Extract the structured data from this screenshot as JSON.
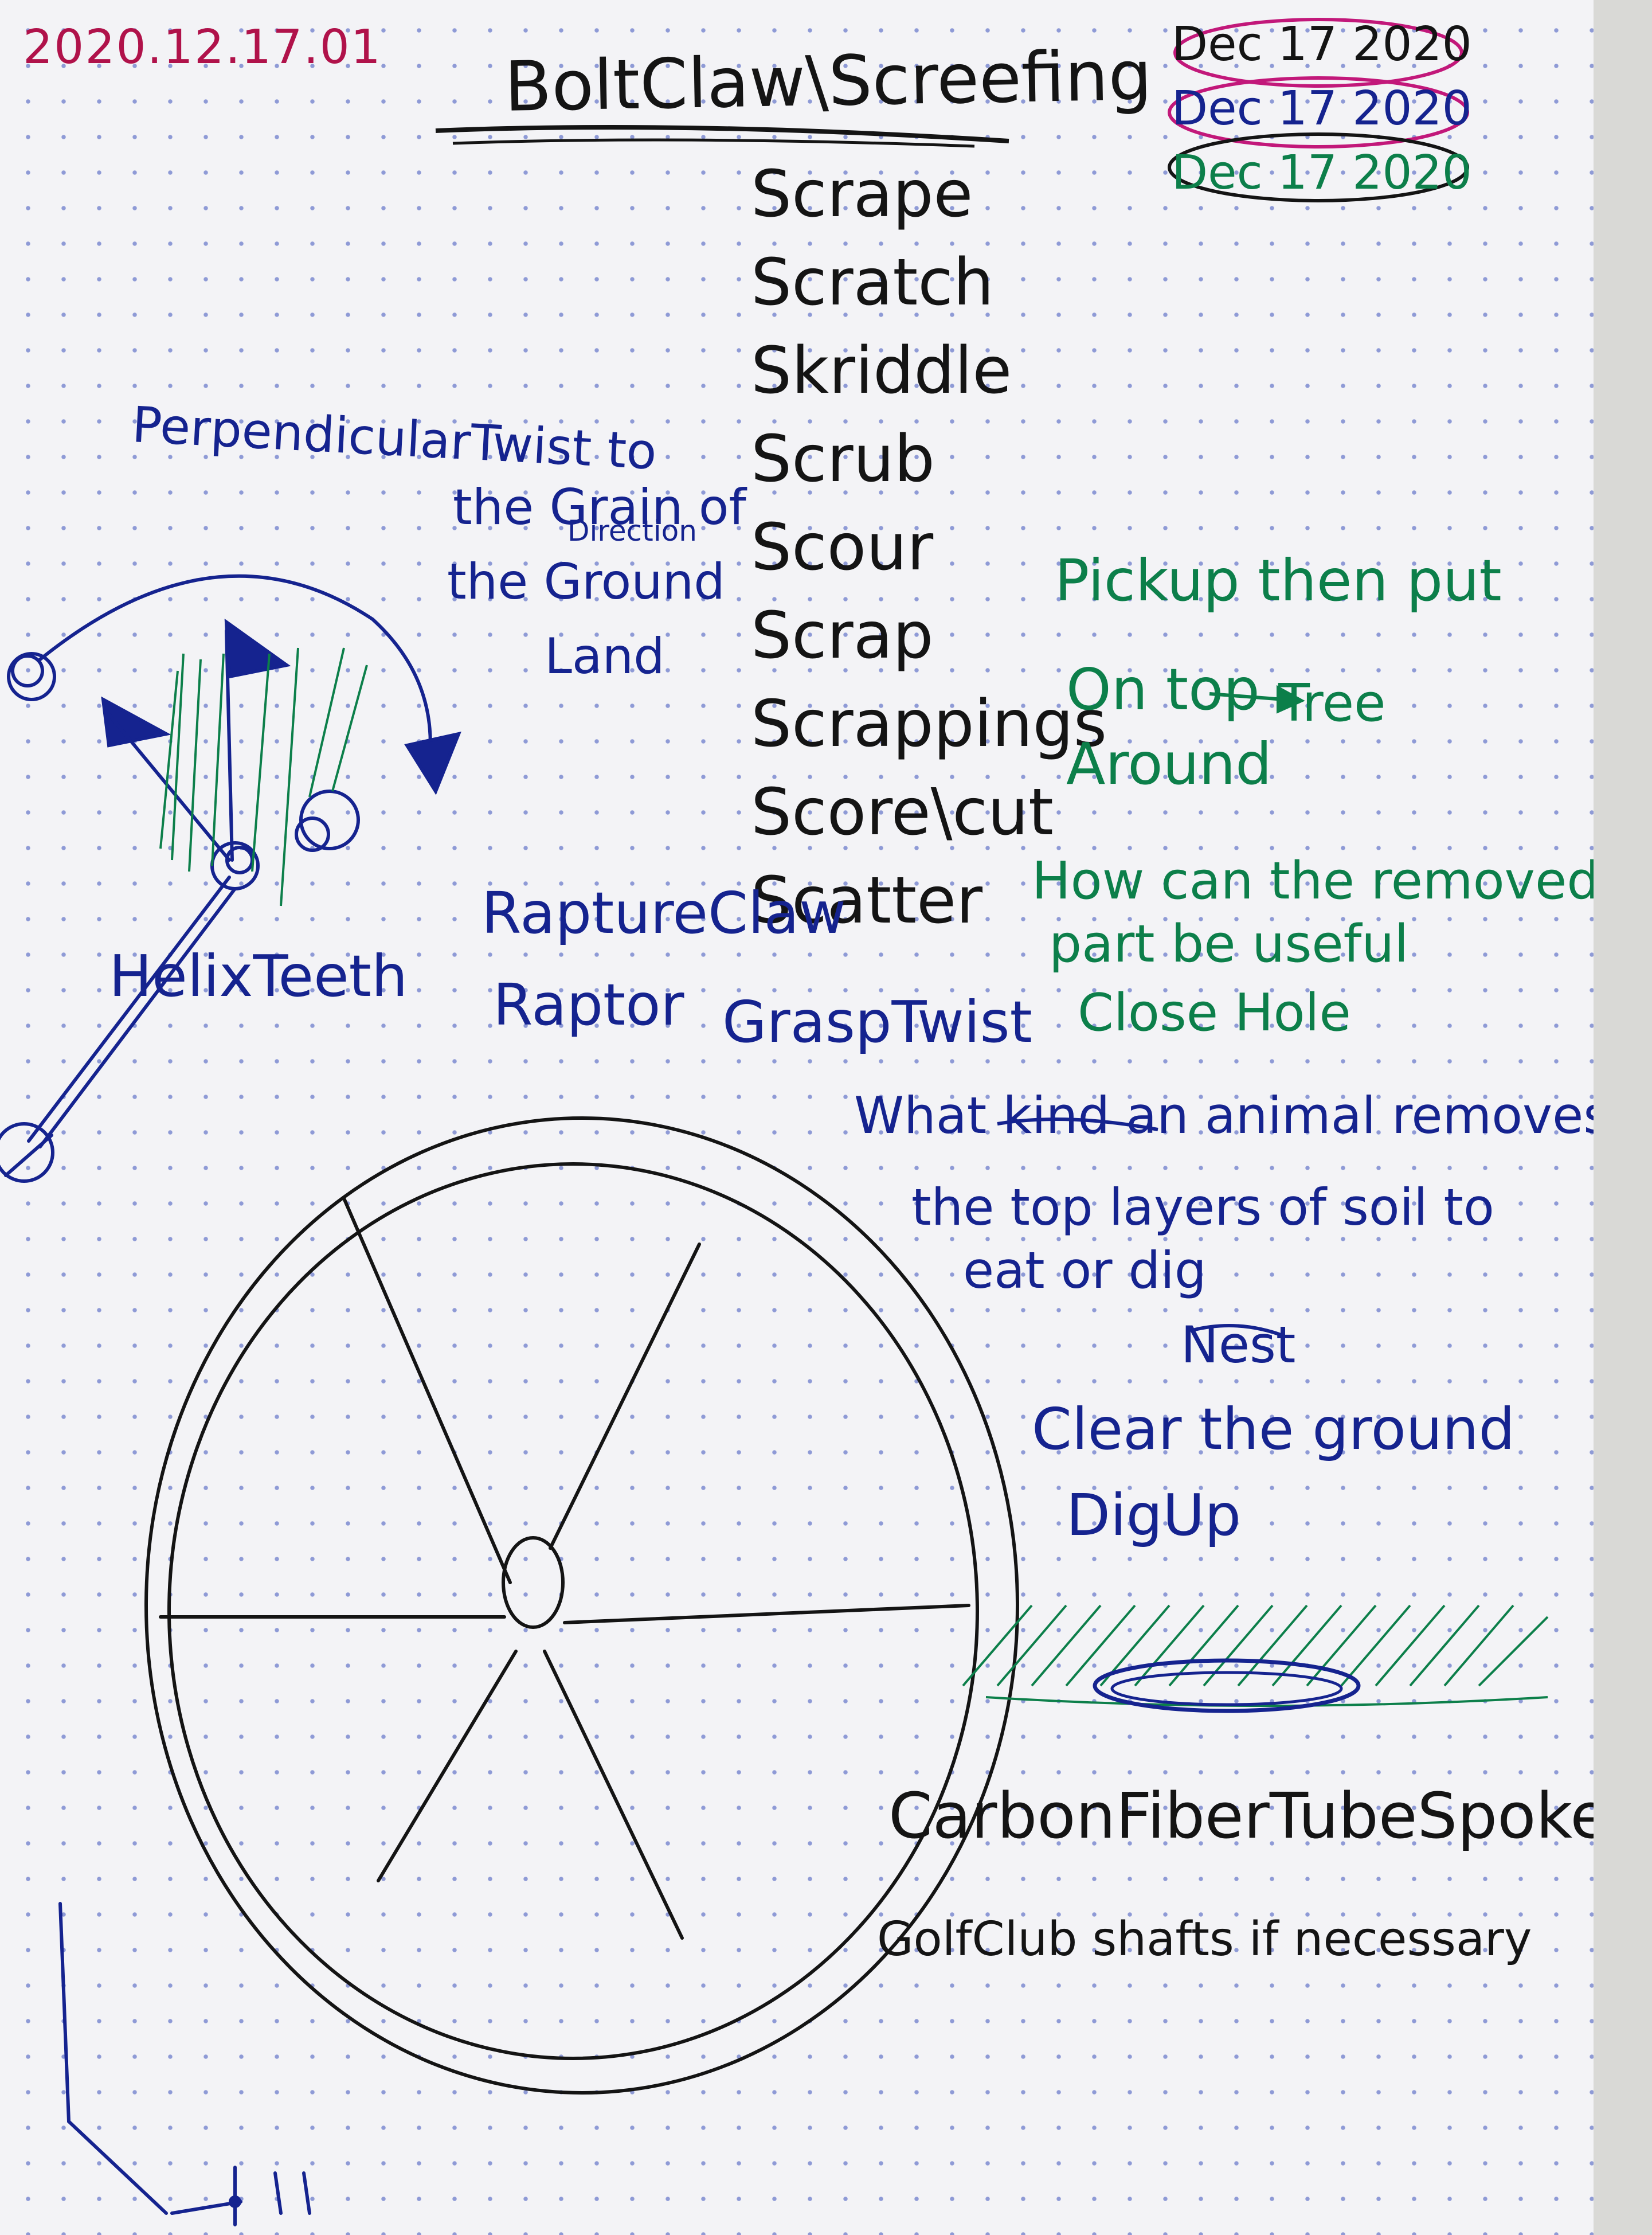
{
  "header": {
    "date_stamp": "2020.12.17.01",
    "title": "BoltClaw\\Screefing",
    "date_entries": [
      "Dec 17 2020",
      "Dec 17 2020",
      "Dec 17 2020"
    ]
  },
  "word_list": [
    "Scrape",
    "Scratch",
    "Skriddle",
    "Scrub",
    "Scour",
    "Scrap",
    "Scrappings",
    "Score\\cut",
    "Scatter"
  ],
  "blue_notes": {
    "perpendicular_line1": "PerpendicularTwist to",
    "perpendicular_line2": "the Grain of",
    "perpendicular_insert": "Direction",
    "perpendicular_line3": "the Ground",
    "perpendicular_line4": "Land",
    "helix": "HelixTeeth",
    "rapture_line1": "RaptureClaw",
    "rapture_line2": "Raptor",
    "grasp": "GraspTwist",
    "question_line1": "What kind an animal removes",
    "question_line2": "the top layers of soil to",
    "question_line3": "eat or dig",
    "nest": "Nest",
    "clear": "Clear the ground",
    "digup": "DigUp"
  },
  "green_notes": {
    "pickup_line1": "Pickup then put",
    "pickup_line2": "On top",
    "pickup_insert": "Tree",
    "pickup_line3": "Around",
    "removed_line1": "How can the removed",
    "removed_line2": "part be useful",
    "removed_line3": "Close Hole"
  },
  "black_notes": {
    "carbon": "CarbonFiberTubeSpokes",
    "golf": "GolfClub shafts if necessary"
  },
  "colors": {
    "paper": "#f3f3f6",
    "grid_dots": "#8e9ad6",
    "ink_black": "#141414",
    "ink_blue": "#15238f",
    "ink_green": "#0c7f4a",
    "ink_red": "#b0124a",
    "highlight_magenta": "#c2187a"
  }
}
